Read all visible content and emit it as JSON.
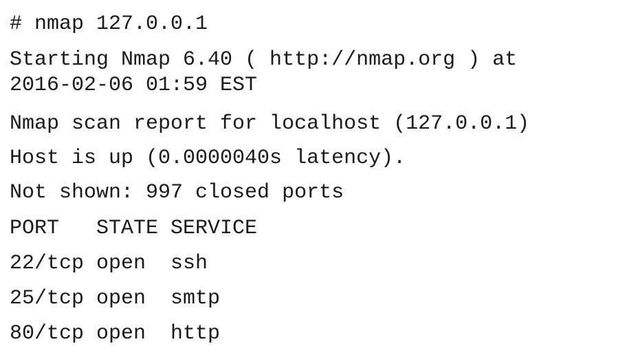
{
  "terminal": {
    "command_line": "# nmap 127.0.0.1",
    "starting_line_1": "Starting Nmap 6.40 ( http://nmap.org ) at",
    "starting_line_2": "2016-02-06 01:59 EST",
    "scan_report": "Nmap scan report for localhost (127.0.0.1)",
    "host_status": "Host is up (0.0000040s latency).",
    "not_shown": "Not shown: 997 closed ports",
    "ports_header": "PORT   STATE SERVICE",
    "ports": [
      {
        "line": "22/tcp open  ssh"
      },
      {
        "line": "25/tcp open  smtp"
      },
      {
        "line": "80/tcp open  http"
      }
    ]
  }
}
